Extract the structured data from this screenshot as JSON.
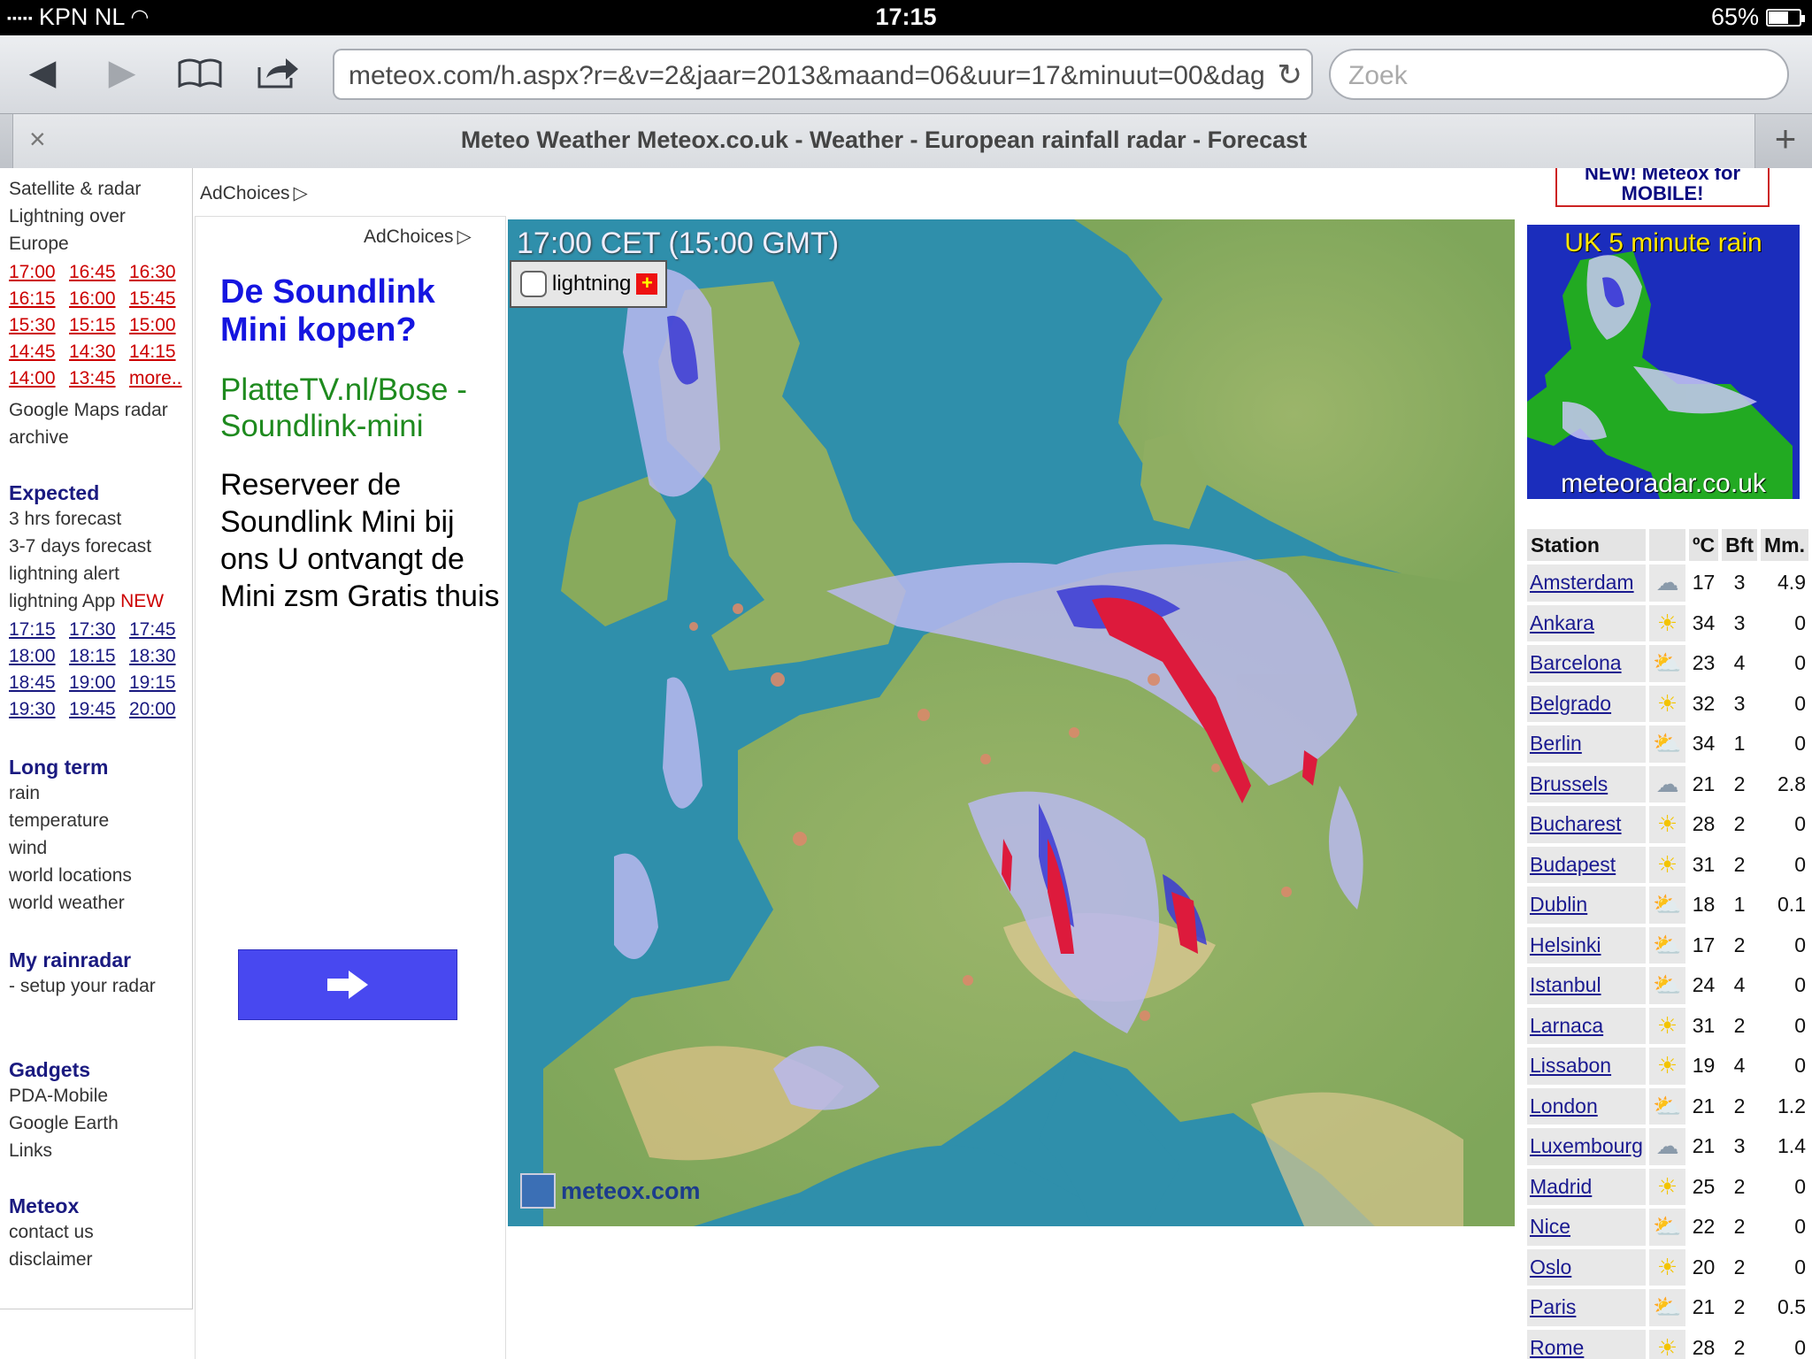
{
  "status_bar": {
    "carrier": "KPN NL",
    "time": "17:15",
    "battery": "65%",
    "battery_level": 0.65
  },
  "browser": {
    "url": "meteox.com/h.aspx?r=&v=2&jaar=2013&maand=06&uur=17&minuut=00&dag",
    "search_placeholder": "Zoek",
    "tab_title": "Meteo Weather Meteox.co.uk - Weather - European rainfall radar - Forecast",
    "tab_close": "×",
    "tab_add": "+"
  },
  "left_nav": {
    "satellite": "Satellite & radar",
    "lightning_over": "Lightning over",
    "europe": "Europe",
    "past_times": [
      [
        "17:00",
        "16:45",
        "16:30"
      ],
      [
        "16:15",
        "16:00",
        "15:45"
      ],
      [
        "15:30",
        "15:15",
        "15:00"
      ],
      [
        "14:45",
        "14:30",
        "14:15"
      ],
      [
        "14:00",
        "13:45",
        "more.."
      ]
    ],
    "google_maps": "Google Maps radar",
    "archive": "archive",
    "expected_heading": "Expected",
    "forecast_3h": "3 hrs forecast",
    "forecast_3_7": "3-7 days forecast",
    "lightning_alert": "lightning alert",
    "lightning_app": "lightning App",
    "new_label": "NEW",
    "future_times": [
      [
        "17:15",
        "17:30",
        "17:45"
      ],
      [
        "18:00",
        "18:15",
        "18:30"
      ],
      [
        "18:45",
        "19:00",
        "19:15"
      ],
      [
        "19:30",
        "19:45",
        "20:00"
      ]
    ],
    "longterm_heading": "Long term",
    "rain": "rain",
    "temperature": "temperature",
    "wind": "wind",
    "world_locations": "world locations",
    "world_weather": "world weather",
    "myradar_heading": "My rainradar",
    "setup": "- setup your radar",
    "gadgets_heading": "Gadgets",
    "pda": "PDA-Mobile",
    "google_earth": "Google Earth",
    "links": "Links",
    "meteox_heading": "Meteox",
    "contact": "contact us",
    "disclaimer": "disclaimer"
  },
  "ads": {
    "adchoices": "AdChoices",
    "title": "De Soundlink Mini kopen?",
    "url": "PlatteTV.nl/Bose -Soundlink-mini",
    "body": "Reserveer de Soundlink Mini bij ons U ontvangt de Mini zsm Gratis thuis"
  },
  "radar": {
    "timestamp": "17:00 CET (15:00 GMT)",
    "lightning_label": "lightning",
    "logo_text": "meteox.com"
  },
  "right": {
    "mobile_banner": "NEW! Meteox for MOBILE!",
    "uk_title": "UK 5 minute rain",
    "uk_footer": "meteoradar.co.uk",
    "table_headers": [
      "Station",
      "",
      "ºC",
      "Bft",
      "Mm."
    ],
    "stations": [
      {
        "name": "Amsterdam",
        "icon": "rain-cloud-icon",
        "temp": "17",
        "bft": "3",
        "mm": "4.9"
      },
      {
        "name": "Ankara",
        "icon": "sun-icon",
        "temp": "34",
        "bft": "3",
        "mm": "0"
      },
      {
        "name": "Barcelona",
        "icon": "sun-cloud-icon",
        "temp": "23",
        "bft": "4",
        "mm": "0"
      },
      {
        "name": "Belgrado",
        "icon": "sun-icon",
        "temp": "32",
        "bft": "3",
        "mm": "0"
      },
      {
        "name": "Berlin",
        "icon": "sun-cloud-icon",
        "temp": "34",
        "bft": "1",
        "mm": "0"
      },
      {
        "name": "Brussels",
        "icon": "rain-cloud-icon",
        "temp": "21",
        "bft": "2",
        "mm": "2.8"
      },
      {
        "name": "Bucharest",
        "icon": "sun-icon",
        "temp": "28",
        "bft": "2",
        "mm": "0"
      },
      {
        "name": "Budapest",
        "icon": "sun-icon",
        "temp": "31",
        "bft": "2",
        "mm": "0"
      },
      {
        "name": "Dublin",
        "icon": "sun-cloud-icon",
        "temp": "18",
        "bft": "1",
        "mm": "0.1"
      },
      {
        "name": "Helsinki",
        "icon": "sun-cloud-icon",
        "temp": "17",
        "bft": "2",
        "mm": "0"
      },
      {
        "name": "Istanbul",
        "icon": "sun-cloud-icon",
        "temp": "24",
        "bft": "4",
        "mm": "0"
      },
      {
        "name": "Larnaca",
        "icon": "sun-icon",
        "temp": "31",
        "bft": "2",
        "mm": "0"
      },
      {
        "name": "Lissabon",
        "icon": "sun-icon",
        "temp": "19",
        "bft": "4",
        "mm": "0"
      },
      {
        "name": "London",
        "icon": "sun-rain-icon",
        "temp": "21",
        "bft": "2",
        "mm": "1.2"
      },
      {
        "name": "Luxembourg",
        "icon": "cloud-icon",
        "temp": "21",
        "bft": "3",
        "mm": "1.4"
      },
      {
        "name": "Madrid",
        "icon": "sun-icon",
        "temp": "25",
        "bft": "2",
        "mm": "0"
      },
      {
        "name": "Nice",
        "icon": "sun-cloud-icon",
        "temp": "22",
        "bft": "2",
        "mm": "0"
      },
      {
        "name": "Oslo",
        "icon": "sun-icon",
        "temp": "20",
        "bft": "2",
        "mm": "0"
      },
      {
        "name": "Paris",
        "icon": "sun-rain-icon",
        "temp": "21",
        "bft": "2",
        "mm": "0.5"
      },
      {
        "name": "Rome",
        "icon": "sun-icon",
        "temp": "28",
        "bft": "2",
        "mm": "0"
      }
    ]
  }
}
